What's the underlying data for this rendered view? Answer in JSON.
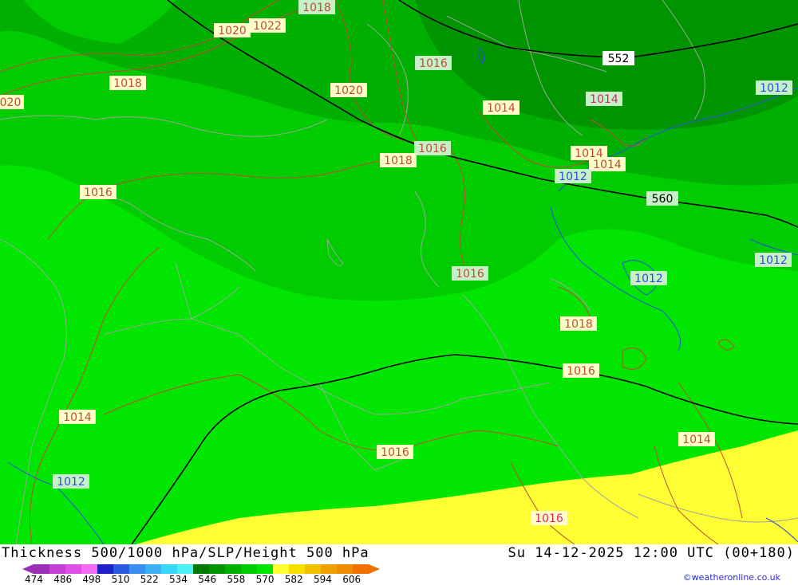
{
  "header": {
    "title": "Thickness 500/1000 hPa/SLP/Height 500 hPa",
    "datetime": "Su 14-12-2025 12:00 UTC (00+180)",
    "credit": "©weatheronline.co.uk"
  },
  "legend": {
    "colors": [
      "#9a2fb5",
      "#c63fd6",
      "#e04fe8",
      "#f26cf2",
      "#2020c8",
      "#2a5ae0",
      "#3a8ef0",
      "#3cb2f5",
      "#38d6f8",
      "#4df0f4",
      "#007a00",
      "#009400",
      "#00b000",
      "#00cc00",
      "#00e600",
      "#ffff33",
      "#f5e000",
      "#f0c000",
      "#eea000",
      "#ef8c00",
      "#f07000"
    ],
    "labels": [
      "474",
      "486",
      "498",
      "510",
      "522",
      "534",
      "546",
      "558",
      "570",
      "582",
      "594",
      "606"
    ]
  },
  "map": {
    "slp_labels": [
      "1018",
      "1020",
      "1022",
      "1016",
      "1018",
      "1020",
      "020",
      "1014",
      "1014",
      "1016",
      "1018",
      "1014",
      "1014",
      "1016",
      "1016",
      "1014",
      "1016",
      "1018",
      "1016",
      "1014",
      "1016",
      "1014",
      "1016"
    ],
    "slp_low_labels": [
      "1012",
      "1012",
      "1012",
      "1012",
      "1012"
    ],
    "height_labels": [
      "552",
      "560"
    ]
  }
}
